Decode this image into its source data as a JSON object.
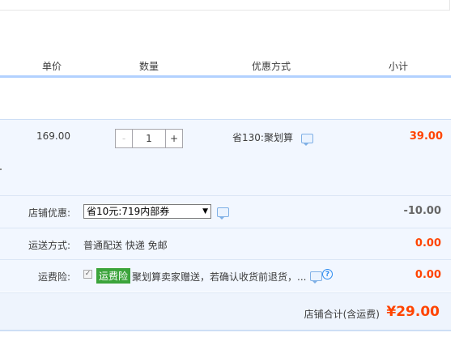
{
  "header": {
    "col_price": "单价",
    "col_qty": "数量",
    "col_promo": "优惠方式",
    "col_subtotal": "小计"
  },
  "item": {
    "price": "169.00",
    "qty_minus": "-",
    "quantity": "1",
    "qty_plus": "+",
    "promo_text": "省130:聚划算",
    "subtotal": "39.00"
  },
  "shop_discount": {
    "label": "店铺优惠:",
    "selected_option": "省10元:719内部券",
    "amount": "-10.00"
  },
  "shipping": {
    "label": "运送方式:",
    "method": "普通配送 快递 免邮",
    "amount": "0.00"
  },
  "insurance": {
    "label": "运费险:",
    "tag": "运费险",
    "text": "聚划算卖家赠送，若确认收货前退货，...",
    "amount": "0.00",
    "help_glyph": "?"
  },
  "total": {
    "label": "店铺合计(含运费)",
    "value": "¥29.00"
  },
  "icons": {
    "chat": "chat-bubble-icon",
    "help": "question-circle-icon",
    "dropdown": "chevron-down-icon"
  },
  "colors": {
    "price_red": "#ff4400",
    "row_bg": "#f2f7ff",
    "header_line": "#b2d1ff",
    "tag_green": "#3ba43b"
  }
}
